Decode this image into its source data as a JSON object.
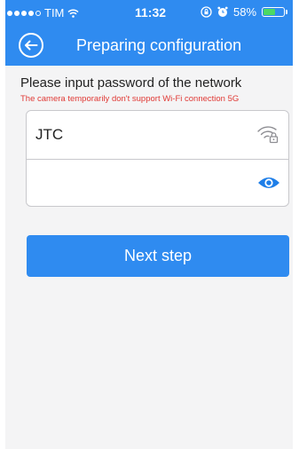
{
  "status_bar": {
    "carrier": "TIM",
    "time": "11:32",
    "battery": "58%",
    "battery_level": 0.58,
    "signal_bars": 4,
    "signal_max": 5,
    "battery_fill_color": "#4cd964"
  },
  "nav": {
    "title": "Preparing configuration",
    "back_icon": "back-circle-arrow-icon",
    "background_color": "#2f8bf0"
  },
  "prompt": "Please input password of the network",
  "warning": "The camera temporarily don't support Wi-Fi connection 5G",
  "warning_color": "#e03a36",
  "form": {
    "ssid_value": "JTC",
    "ssid_icon": "wifi-lock-icon",
    "password_value": "",
    "password_placeholder": "",
    "password_icon": "eye-icon"
  },
  "next_button": {
    "label": "Next step",
    "color": "#2f8bf0"
  }
}
